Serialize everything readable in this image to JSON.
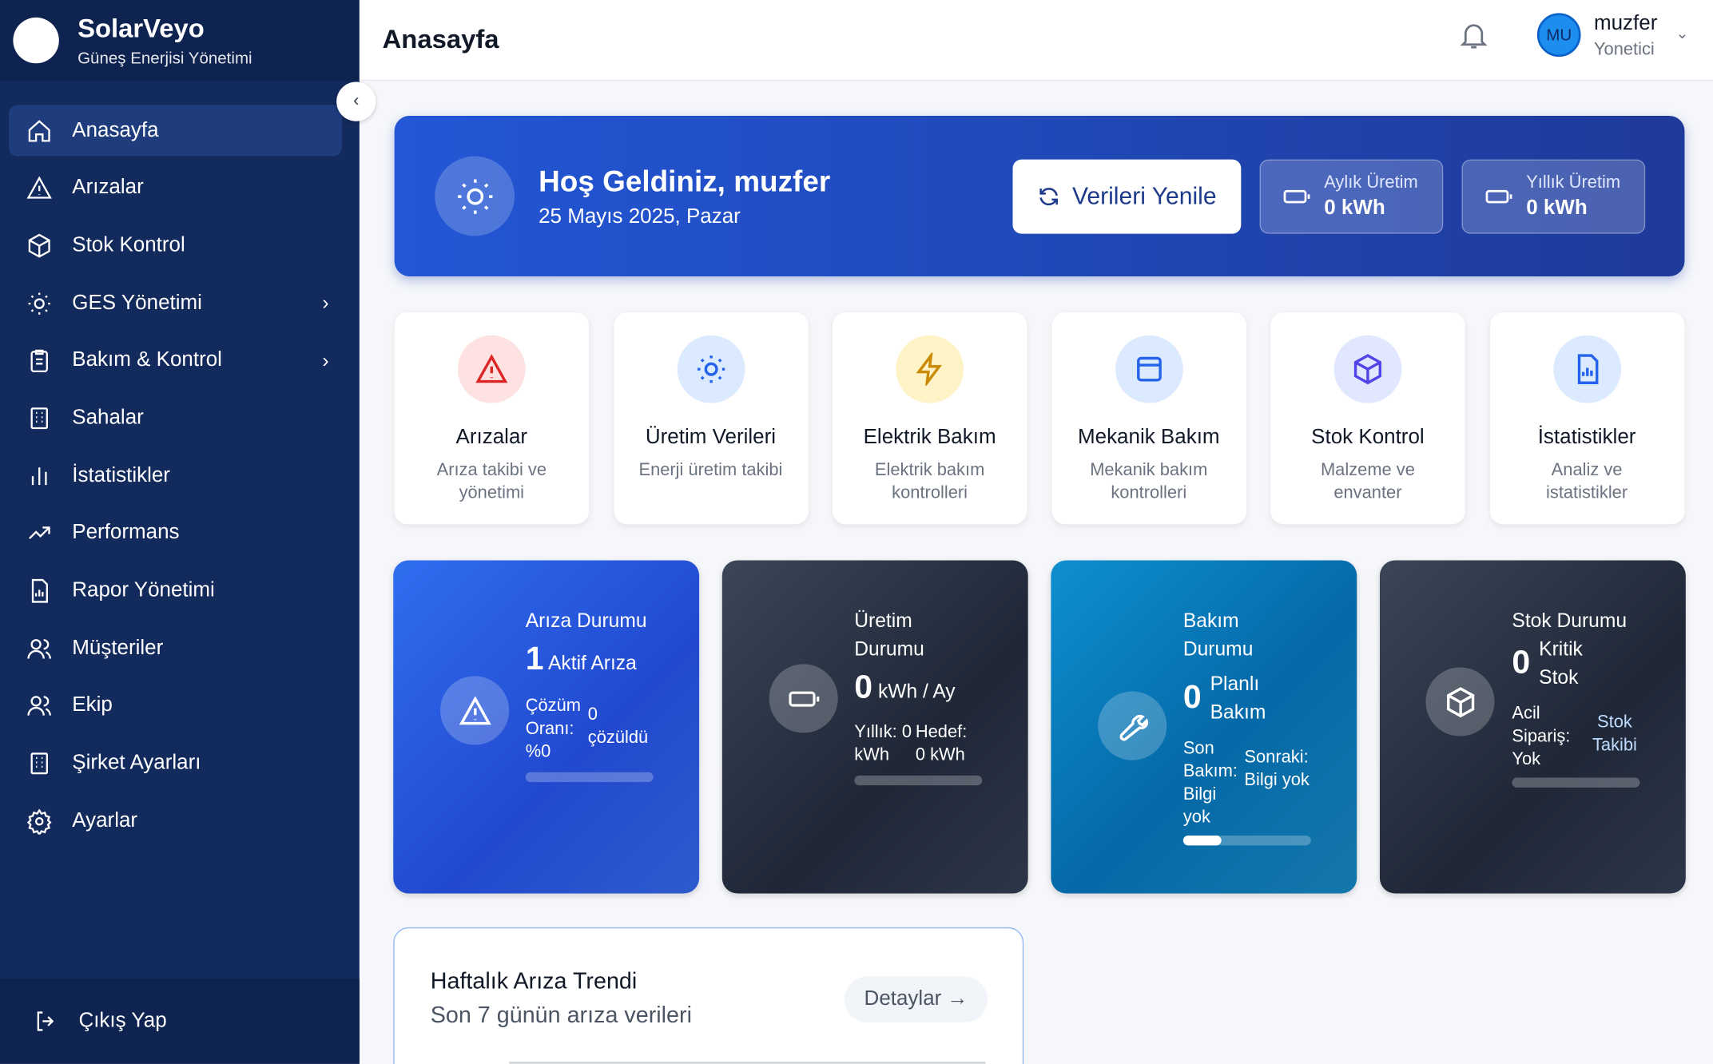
{
  "brand": {
    "name": "SolarVeyo",
    "subtitle": "Güneş Enerjisi Yönetimi"
  },
  "sidebar": {
    "items": [
      {
        "label": "Anasayfa",
        "icon": "home-icon"
      },
      {
        "label": "Arızalar",
        "icon": "warning-icon"
      },
      {
        "label": "Stok Kontrol",
        "icon": "box-icon"
      },
      {
        "label": "GES Yönetimi",
        "icon": "sun-icon",
        "has_children": true
      },
      {
        "label": "Bakım & Kontrol",
        "icon": "clipboard-icon",
        "has_children": true
      },
      {
        "label": "Sahalar",
        "icon": "building-icon"
      },
      {
        "label": "İstatistikler",
        "icon": "bar-chart-icon"
      },
      {
        "label": "Performans",
        "icon": "trend-icon"
      },
      {
        "label": "Rapor Yönetimi",
        "icon": "report-icon"
      },
      {
        "label": "Müşteriler",
        "icon": "users-icon"
      },
      {
        "label": "Ekip",
        "icon": "team-icon"
      },
      {
        "label": "Şirket Ayarları",
        "icon": "building-icon"
      },
      {
        "label": "Ayarlar",
        "icon": "gear-icon"
      }
    ],
    "logout": "Çıkış Yap"
  },
  "header": {
    "title": "Anasayfa",
    "user": {
      "initials": "MU",
      "name": "muzfer",
      "role": "Yonetici"
    }
  },
  "hero": {
    "title": "Hoş Geldiniz, muzfer",
    "date": "25 Mayıs 2025, Pazar",
    "refresh": "Verileri Yenile",
    "stats": [
      {
        "label": "Aylık Üretim",
        "value": "0 kWh"
      },
      {
        "label": "Yıllık Üretim",
        "value": "0 kWh"
      }
    ]
  },
  "quick": [
    {
      "title": "Arızalar",
      "desc": "Arıza takibi ve yönetimi",
      "color": "#dc2626",
      "bg": "#fee2e2"
    },
    {
      "title": "Üretim Verileri",
      "desc": "Enerji üretim takibi",
      "color": "#2563eb",
      "bg": "#dbeafe"
    },
    {
      "title": "Elektrik Bakım",
      "desc": "Elektrik bakım kontrolleri",
      "color": "#ca8a04",
      "bg": "#fef3c7"
    },
    {
      "title": "Mekanik Bakım",
      "desc": "Mekanik bakım kontrolleri",
      "color": "#2563eb",
      "bg": "#dbeafe"
    },
    {
      "title": "Stok Kontrol",
      "desc": "Malzeme ve envanter",
      "color": "#4f46e5",
      "bg": "#e0e7ff"
    },
    {
      "title": "İstatistikler",
      "desc": "Analiz ve istatistikler",
      "color": "#2563eb",
      "bg": "#dbeafe"
    }
  ],
  "status": {
    "fault": {
      "title": "Arıza Durumu",
      "count": "1",
      "count_label": "Aktif Arıza",
      "rate_label": "Çözüm Oranı: %0",
      "resolved": "0 çözüldü",
      "progress": 0
    },
    "production": {
      "title": "Üretim Durumu",
      "value": "0",
      "unit": "kWh / Ay",
      "yearly": "Yıllık: 0 kWh",
      "target": "Hedef: 0 kWh",
      "progress": 0
    },
    "maintenance": {
      "title": "Bakım Durumu",
      "count": "0",
      "count_label": "Planlı Bakım",
      "last": "Son Bakım: Bilgi yok",
      "next": "Sonraki: Bilgi yok",
      "progress": 30
    },
    "stock": {
      "title": "Stok Durumu",
      "count": "0",
      "count_label": "Kritik Stok",
      "urgent": "Acil Sipariş: Yok",
      "link": "Stok Takibi",
      "progress": 0
    }
  },
  "trend": {
    "title": "Haftalık Arıza Trendi",
    "subtitle": "Son 7 günün arıza verileri",
    "details": "Detaylar →"
  }
}
